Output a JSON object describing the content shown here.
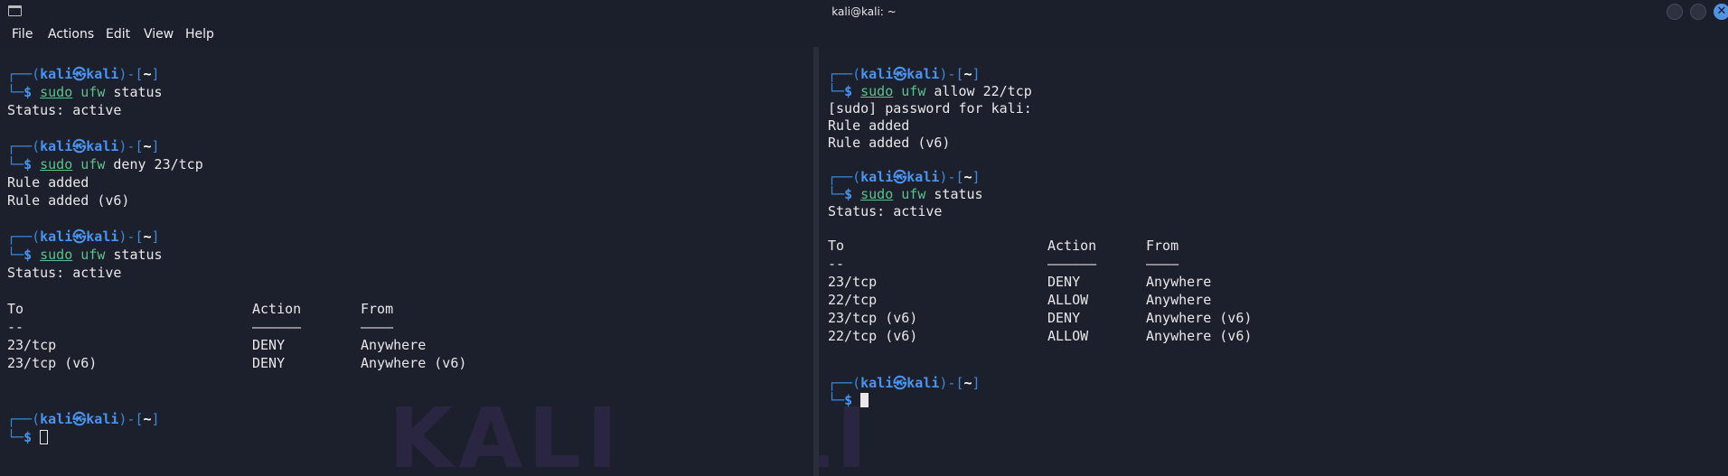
{
  "window": {
    "title": "kali@kali: ~",
    "close_glyph": "✕"
  },
  "menu": [
    "File",
    "Actions",
    "Edit",
    "View",
    "Help"
  ],
  "prompt": {
    "open": "┌──(",
    "user": "kali",
    "at": "㉿",
    "host": "kali",
    "mid": ")-[",
    "path": "~",
    "close": "]",
    "corner": "└─",
    "dollar": "$"
  },
  "left_pane": {
    "blocks": [
      {
        "sudo": "sudo",
        "ufw": "ufw",
        "args": "status",
        "output": [
          "Status: active"
        ]
      },
      {
        "sudo": "sudo",
        "ufw": "ufw",
        "args": "deny 23/tcp",
        "output": [
          "Rule added",
          "Rule added (v6)"
        ]
      },
      {
        "sudo": "sudo",
        "ufw": "ufw",
        "args": "status",
        "output": [
          "Status: active"
        ]
      }
    ],
    "table": {
      "headers": [
        "To",
        "Action",
        "From"
      ],
      "separators": [
        "--",
        "——————",
        "————"
      ],
      "rows": [
        [
          "23/tcp",
          "DENY",
          "Anywhere"
        ],
        [
          "23/tcp (v6)",
          "DENY",
          "Anywhere (v6)"
        ]
      ]
    },
    "watermark": "KALI"
  },
  "right_pane": {
    "block1": {
      "sudo": "sudo",
      "ufw": "ufw",
      "args": "allow 22/tcp",
      "output": [
        "[sudo] password for kali:",
        "Rule added",
        "Rule added (v6)"
      ]
    },
    "block2": {
      "sudo": "sudo",
      "ufw": "ufw",
      "args": "status",
      "output": [
        "Status: active"
      ]
    },
    "table": {
      "headers": [
        "To",
        "Action",
        "From"
      ],
      "separators": [
        "--",
        "——————",
        "————"
      ],
      "rows": [
        [
          "23/tcp",
          "DENY",
          "Anywhere"
        ],
        [
          "22/tcp",
          "ALLOW",
          "Anywhere"
        ],
        [
          "23/tcp (v6)",
          "DENY",
          "Anywhere (v6)"
        ],
        [
          "22/tcp (v6)",
          "ALLOW",
          "Anywhere (v6)"
        ]
      ]
    },
    "watermark": "KALI"
  }
}
